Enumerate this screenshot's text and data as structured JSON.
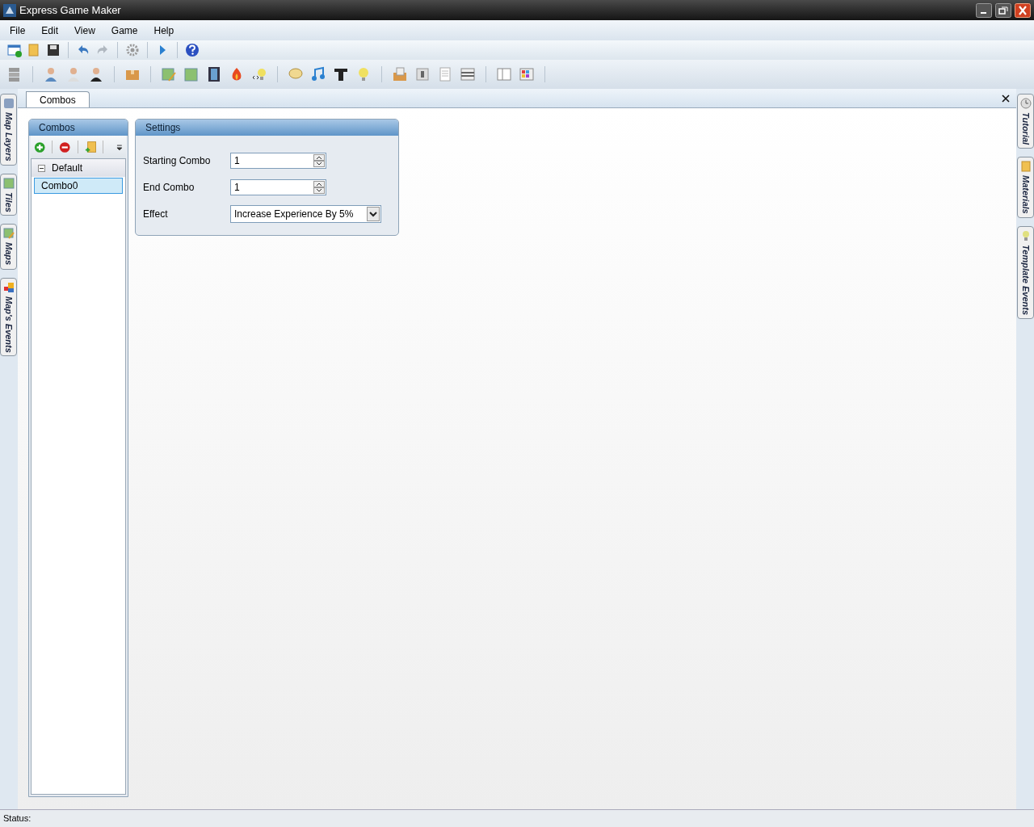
{
  "window": {
    "title": "Express Game Maker"
  },
  "menu": [
    "File",
    "Edit",
    "View",
    "Game",
    "Help"
  ],
  "left_dock_tabs": [
    {
      "label": "Map Layers"
    },
    {
      "label": "Tiles"
    },
    {
      "label": "Maps"
    },
    {
      "label": "Map's Events"
    }
  ],
  "right_dock_tabs": [
    {
      "label": "Tutorial"
    },
    {
      "label": "Materials"
    },
    {
      "label": "Template Events"
    }
  ],
  "document_tabs": [
    {
      "label": "Combos",
      "selected": true
    }
  ],
  "combos_panel": {
    "title": "Combos",
    "tree": [
      {
        "label": "Default",
        "expanded": true,
        "children": [
          {
            "label": "Combo0",
            "selected": true
          }
        ]
      }
    ]
  },
  "settings_panel": {
    "title": "Settings",
    "fields": [
      {
        "kind": "spinner",
        "label": "Starting Combo",
        "value": "1"
      },
      {
        "kind": "spinner",
        "label": "End Combo",
        "value": "1"
      },
      {
        "kind": "dropdown",
        "label": "Effect",
        "value": "Increase Experience By 5%"
      }
    ]
  },
  "status_bar": {
    "label": "Status:"
  }
}
